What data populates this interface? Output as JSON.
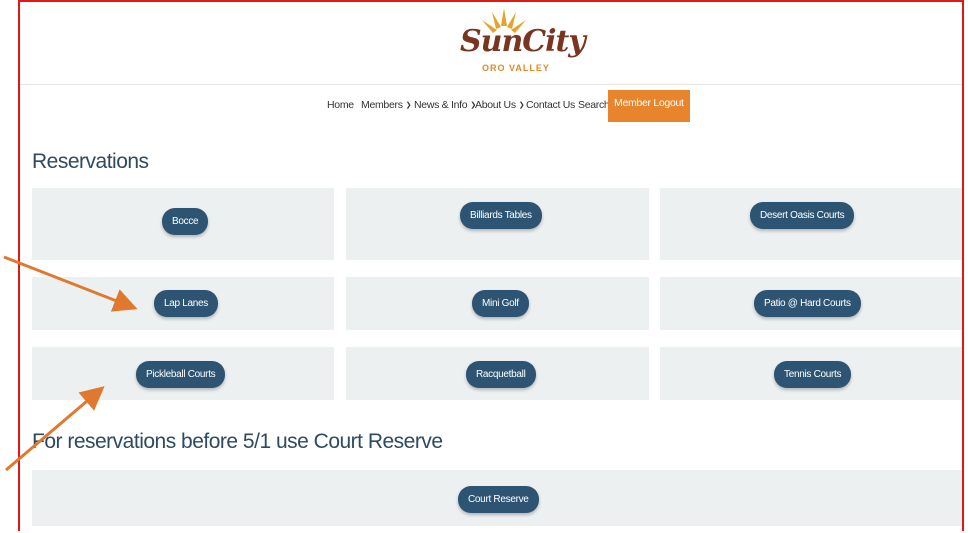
{
  "header": {
    "logo_main": "SunCity",
    "logo_sub": "ORO VALLEY"
  },
  "nav": {
    "home": "Home",
    "members": "Members",
    "news": "News & Info",
    "about": "About Us",
    "contact": "Contact Us",
    "search": "Search",
    "logout": "Member Logout"
  },
  "main": {
    "heading": "Reservations",
    "items": [
      "Bocce",
      "Billiards Tables",
      "Desert Oasis Courts",
      "Lap Lanes",
      "Mini Golf",
      "Patio @ Hard Courts",
      "Pickleball Courts",
      "Racquetball",
      "Tennis Courts"
    ],
    "section2_heading": "For reservations before 5/1 use Court Reserve",
    "court_reserve": "Court Reserve"
  },
  "colors": {
    "button": "#2d5573",
    "tile": "#edf0f1",
    "accent": "#e8842b",
    "frame": "#e01818",
    "arrow": "#e07830"
  }
}
